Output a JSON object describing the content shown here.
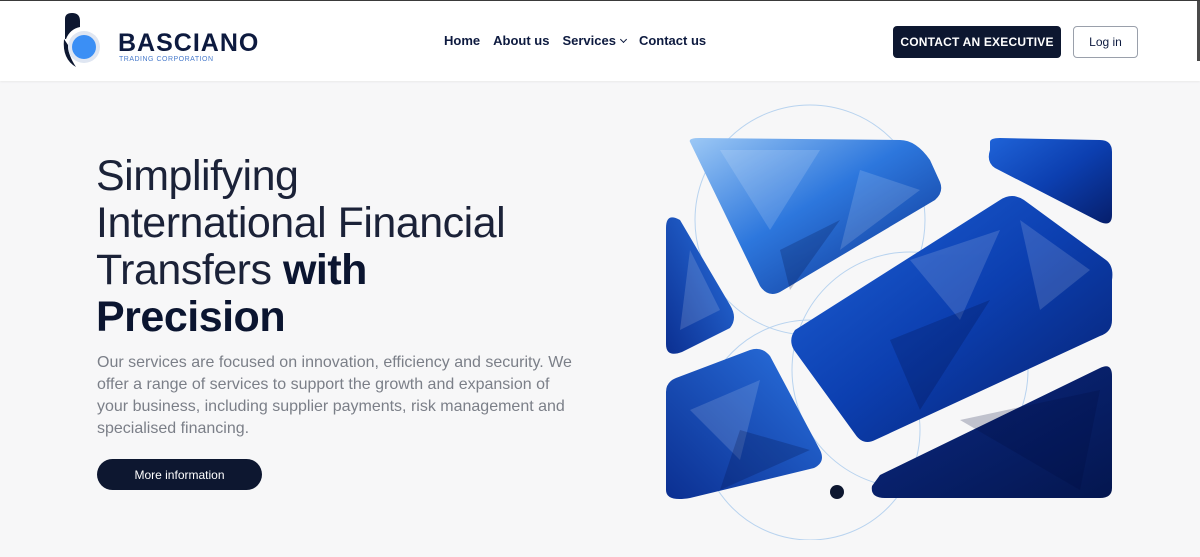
{
  "brand": {
    "name": "BASCIANO",
    "tagline": "TRADING CORPORATION",
    "accent_color": "#3b8ff5",
    "dark_color": "#0d1730"
  },
  "nav": {
    "items": [
      {
        "label": "Home"
      },
      {
        "label": "About us"
      },
      {
        "label": "Services",
        "icon": "chevron-down-icon"
      },
      {
        "label": "Contact us"
      }
    ]
  },
  "header_actions": {
    "contact_label": "CONTACT AN EXECUTIVE",
    "login_label": "Log in"
  },
  "hero": {
    "title_line1": "Simplifying",
    "title_line2": "International Financial",
    "title_line3_light": "Transfers ",
    "title_line3_bold": "with",
    "title_line4_bold": "Precision",
    "description": "Our services are focused on innovation, efficiency and security. We offer a range of services to support the growth and expansion of your business, including supplier payments, risk management and specialised financing.",
    "cta_label": "More information"
  }
}
